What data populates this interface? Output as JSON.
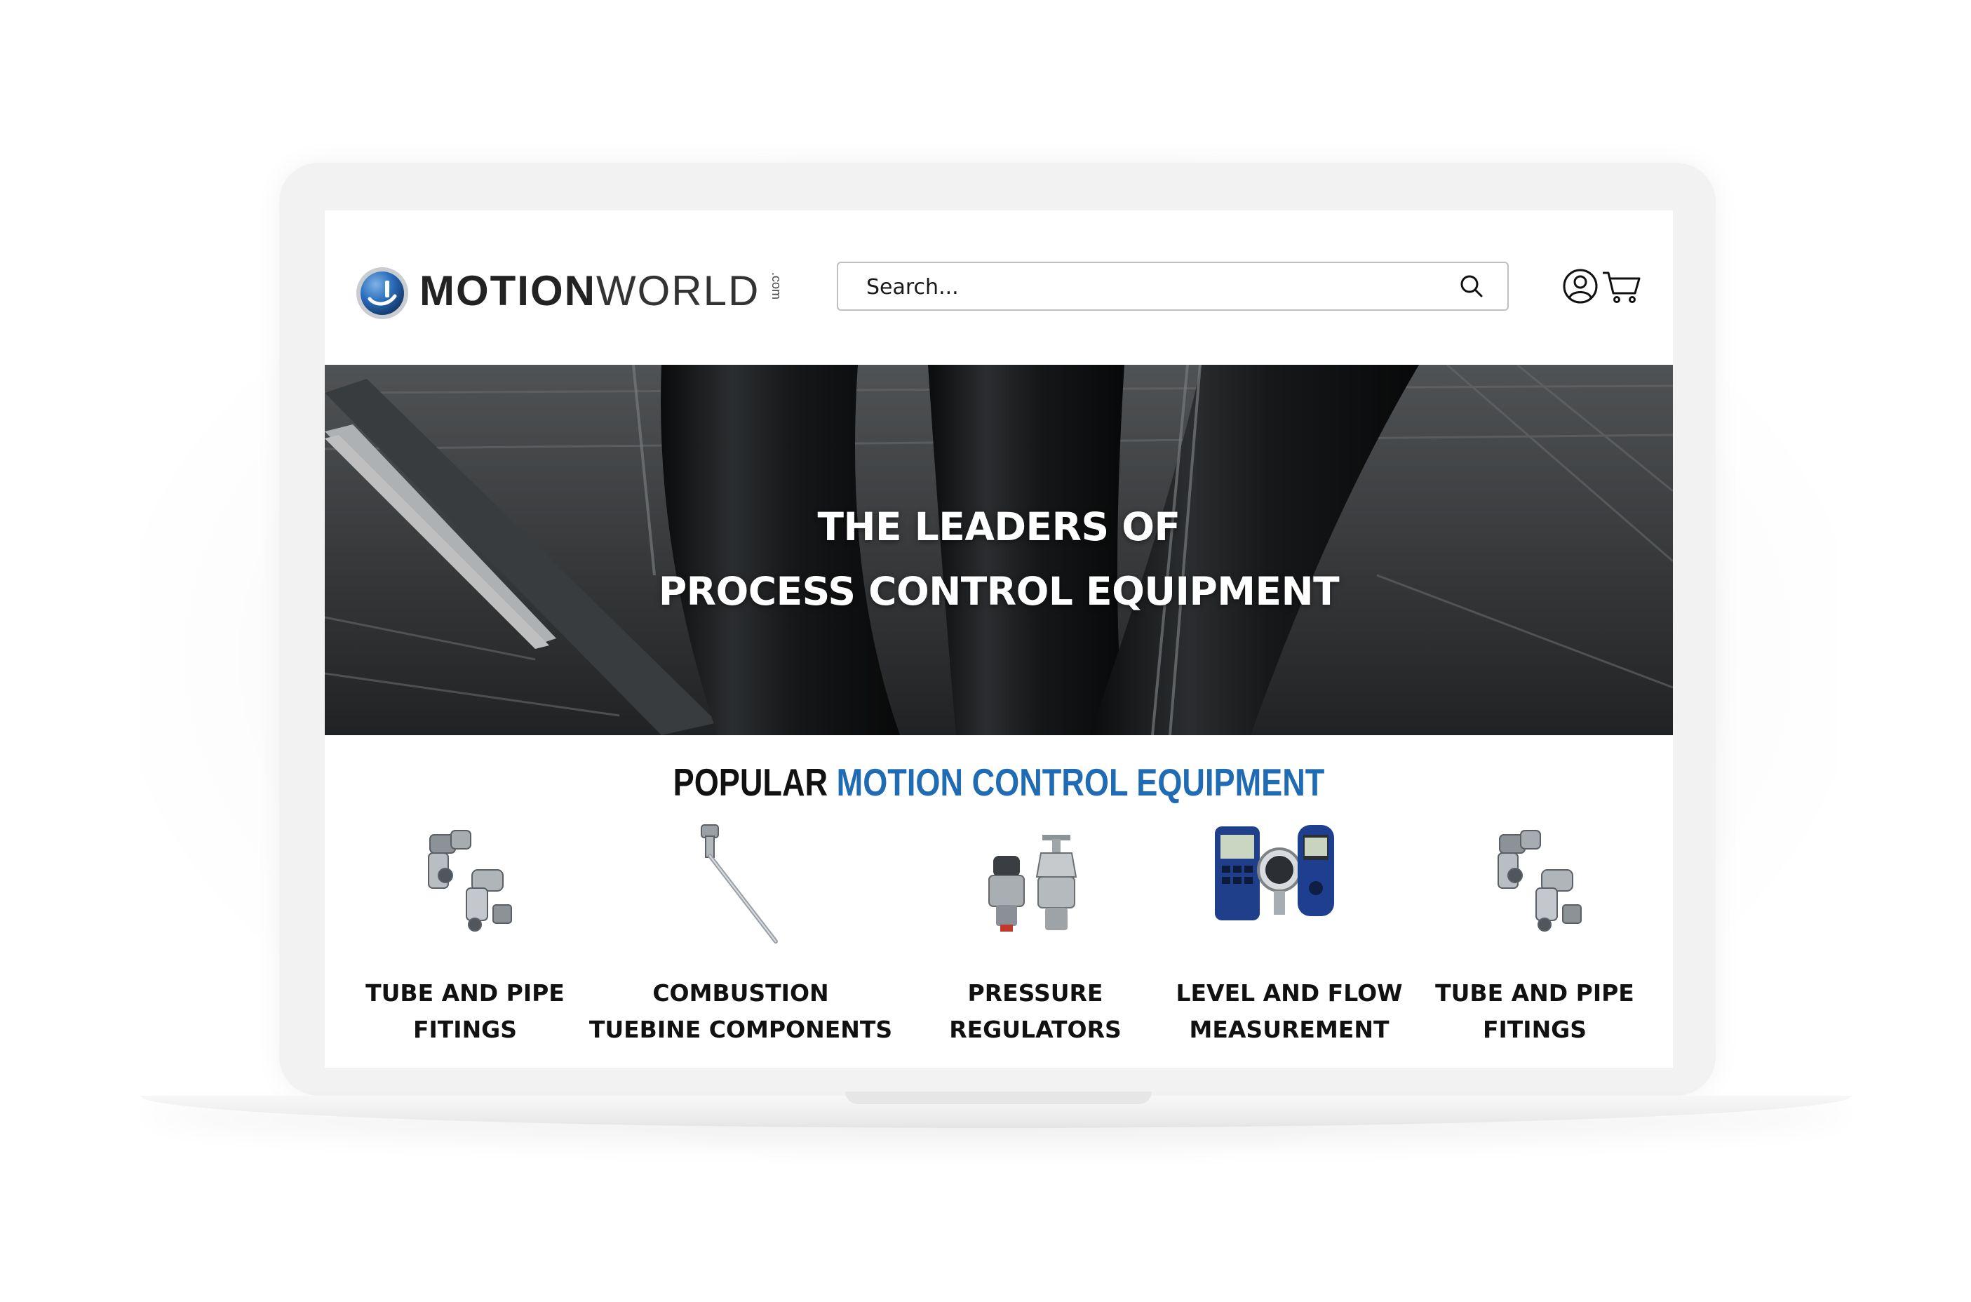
{
  "header": {
    "logo": {
      "brand_bold": "MOTION",
      "brand_light": "WORLD",
      "suffix": ".com"
    },
    "search": {
      "placeholder": "Search..."
    },
    "icons": [
      "user-icon",
      "cart-icon",
      "search-icon"
    ]
  },
  "hero": {
    "line1": "THE LEADERS OF",
    "line2": "PROCESS CONTROL EQUIPMENT"
  },
  "section": {
    "title_dark": "POPULAR",
    "title_blue": "MOTION CONTROL EQUIPMENT"
  },
  "products": [
    {
      "line1": "TUBE AND PIPE",
      "line2": "FITINGS",
      "image": "fittings"
    },
    {
      "line1": "COMBUSTION",
      "line2": "TUEBINE COMPONENTS",
      "image": "thermocouple-probe"
    },
    {
      "line1": "PRESSURE",
      "line2": "REGULATORS",
      "image": "regulators"
    },
    {
      "line1": "LEVEL AND FLOW",
      "line2": "MEASUREMENT",
      "image": "meters"
    },
    {
      "line1": "TUBE AND PIPE",
      "line2": "FITINGS",
      "image": "fittings"
    }
  ],
  "colors": {
    "accent_blue": "#1f6bb4",
    "text_dark": "#111111",
    "logo_blue": "#1d5fa8"
  }
}
